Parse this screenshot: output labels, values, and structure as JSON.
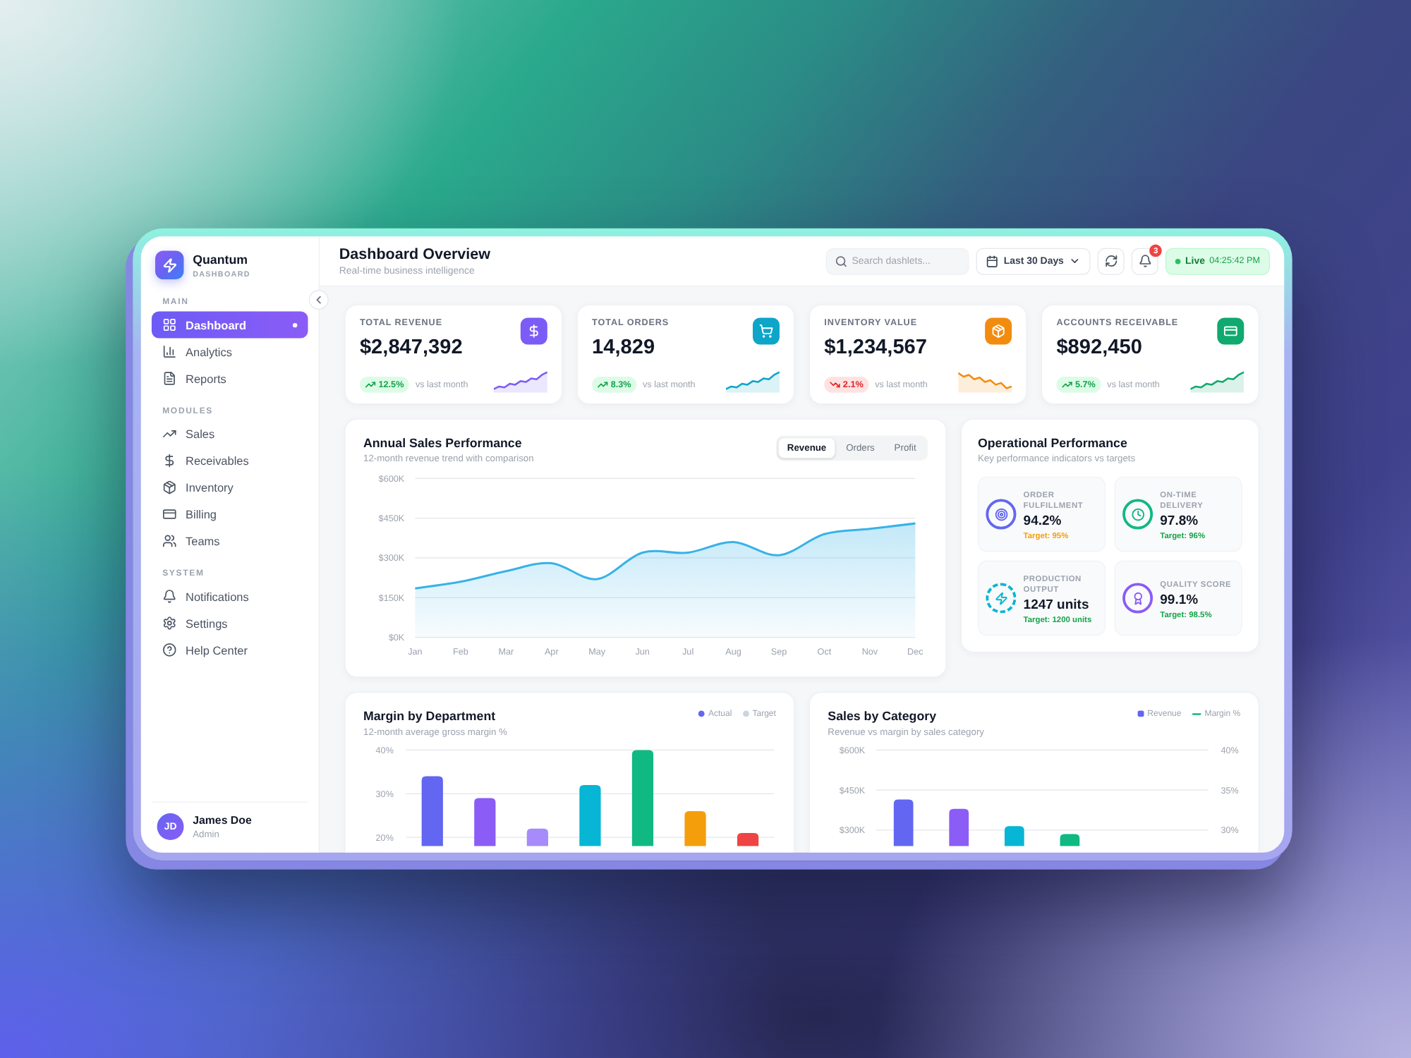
{
  "brand": {
    "name": "Quantum",
    "tagline": "DASHBOARD"
  },
  "sidebar": {
    "sections": [
      {
        "title": "MAIN",
        "items": [
          {
            "label": "Dashboard",
            "selected": true
          },
          {
            "label": "Analytics",
            "selected": false
          },
          {
            "label": "Reports",
            "selected": false
          }
        ]
      },
      {
        "title": "MODULES",
        "items": [
          {
            "label": "Sales",
            "selected": false
          },
          {
            "label": "Receivables",
            "selected": false
          },
          {
            "label": "Inventory",
            "selected": false
          },
          {
            "label": "Billing",
            "selected": false
          },
          {
            "label": "Teams",
            "selected": false
          }
        ]
      },
      {
        "title": "SYSTEM",
        "items": [
          {
            "label": "Notifications",
            "selected": false
          },
          {
            "label": "Settings",
            "selected": false
          },
          {
            "label": "Help Center",
            "selected": false
          }
        ]
      }
    ],
    "user": {
      "initials": "JD",
      "name": "James Doe",
      "role": "Admin"
    }
  },
  "header": {
    "title": "Dashboard Overview",
    "subtitle": "Real-time business intelligence",
    "search": {
      "placeholder": "Search dashlets..."
    },
    "date_range": "Last 30 Days",
    "notification_count": "3",
    "live": {
      "label": "Live",
      "time": "04:25:42 PM"
    }
  },
  "kpis": [
    {
      "label": "TOTAL REVENUE",
      "value": "$2,847,392",
      "change": "12.5%",
      "positive": true,
      "note": "vs last month",
      "color": "#7c5cf6"
    },
    {
      "label": "TOTAL ORDERS",
      "value": "14,829",
      "change": "8.3%",
      "positive": true,
      "note": "vs last month",
      "color": "#0ea5c9"
    },
    {
      "label": "INVENTORY VALUE",
      "value": "$1,234,567",
      "change": "2.1%",
      "positive": false,
      "note": "vs last month",
      "color": "#f28c0f"
    },
    {
      "label": "ACCOUNTS RECEIVABLE",
      "value": "$892,450",
      "change": "5.7%",
      "positive": true,
      "note": "vs last month",
      "color": "#10a96f"
    }
  ],
  "sales_chart": {
    "title": "Annual Sales Performance",
    "subtitle": "12-month revenue trend with comparison",
    "tabs": [
      {
        "label": "Revenue",
        "selected": true
      },
      {
        "label": "Orders",
        "selected": false
      },
      {
        "label": "Profit",
        "selected": false
      }
    ],
    "chart_data": [
      {
        "type": "area",
        "categories": [
          "Jan",
          "Feb",
          "Mar",
          "Apr",
          "May",
          "Jun",
          "Jul",
          "Aug",
          "Sep",
          "Oct",
          "Nov",
          "Dec"
        ],
        "values": [
          185,
          210,
          250,
          280,
          220,
          320,
          320,
          360,
          310,
          390,
          410,
          430
        ],
        "color": "#38b2e8",
        "ylim": [
          0,
          600
        ],
        "yticks": [
          {
            "value": 0,
            "label": "$0K"
          },
          {
            "value": 150,
            "label": "$150K"
          },
          {
            "value": 300,
            "label": "$300K"
          },
          {
            "value": 450,
            "label": "$450K"
          },
          {
            "value": 600,
            "label": "$600K"
          }
        ],
        "grid": true
      }
    ]
  },
  "operations": {
    "title": "Operational Performance",
    "subtitle": "Key performance indicators vs targets",
    "metrics": [
      {
        "label": "ORDER FULFILLMENT",
        "value": "94.2%",
        "target": "Target: 95%",
        "met": false,
        "color": "#6366f1",
        "dashed": false
      },
      {
        "label": "ON-TIME DELIVERY",
        "value": "97.8%",
        "target": "Target: 96%",
        "met": true,
        "color": "#10b981",
        "dashed": false
      },
      {
        "label": "PRODUCTION OUTPUT",
        "value": "1247 units",
        "target": "Target: 1200 units",
        "met": true,
        "color": "#06b6d4",
        "dashed": true
      },
      {
        "label": "QUALITY SCORE",
        "value": "99.1%",
        "target": "Target: 98.5%",
        "met": true,
        "color": "#8b5cf6",
        "dashed": false
      }
    ]
  },
  "margin_chart": {
    "title": "Margin by Department",
    "subtitle": "12-month average gross margin %",
    "legend": [
      {
        "label": "Actual",
        "color": "#6366f1",
        "kind": "dot"
      },
      {
        "label": "Target",
        "color": "#cbd5e1",
        "kind": "dot"
      }
    ],
    "chart_data": [
      {
        "type": "bar",
        "categories": [
          null,
          null,
          null,
          null,
          null,
          null,
          null
        ],
        "values": [
          34,
          29,
          22,
          32,
          40,
          26,
          21
        ],
        "colors": [
          "#6366f1",
          "#8b5cf6",
          "#a78bfa",
          "#06b6d4",
          "#10b981",
          "#f59e0b",
          "#ef4444"
        ],
        "ylim": [
          18,
          40
        ],
        "yticks": [
          {
            "value": 20,
            "label": "20%"
          },
          {
            "value": 30,
            "label": "30%"
          },
          {
            "value": 40,
            "label": "40%"
          }
        ],
        "grid": true
      }
    ]
  },
  "category_chart": {
    "title": "Sales by Category",
    "subtitle": "Revenue vs margin by sales category",
    "legend": [
      {
        "label": "Revenue",
        "color": "#6366f1",
        "kind": "square"
      },
      {
        "label": "Margin %",
        "color": "#10b981",
        "kind": "line"
      }
    ],
    "chart_data": [
      {
        "type": "bar",
        "categories": [
          null,
          null,
          null,
          null,
          null,
          null
        ],
        "values": [
          415,
          380,
          315,
          285,
          null,
          null
        ],
        "colors": [
          "#6366f1",
          "#8b5cf6",
          "#06b6d4",
          "#10b981",
          null,
          null
        ],
        "ylim": [
          240,
          600
        ],
        "y2lim": [
          28,
          40
        ],
        "yticks": [
          {
            "value": 300,
            "label": "$300K"
          },
          {
            "value": 450,
            "label": "$450K"
          },
          {
            "value": 600,
            "label": "$600K"
          }
        ],
        "y2ticks": [
          {
            "value": 30,
            "label": "30%"
          },
          {
            "value": 35,
            "label": "35%"
          },
          {
            "value": 40,
            "label": "40%"
          }
        ],
        "grid": true
      }
    ]
  }
}
